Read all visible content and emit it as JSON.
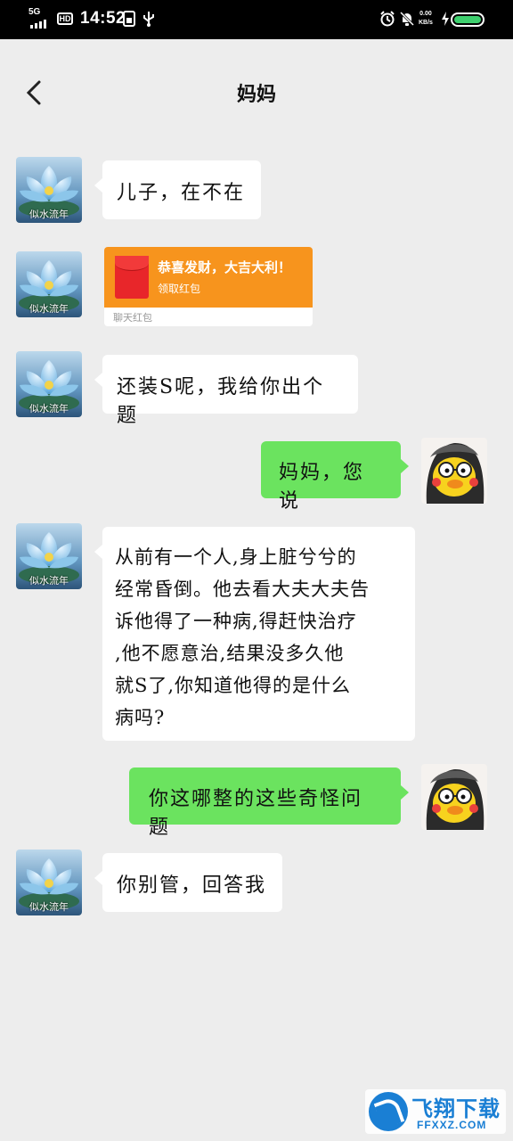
{
  "status_bar": {
    "network": "5G",
    "hd": "HD",
    "time": "14:52",
    "speed_value": "0.00",
    "speed_unit": "KB/s",
    "battery_level": 1.0,
    "battery_color": "#3ecf6e"
  },
  "header": {
    "title": "妈妈"
  },
  "avatars": {
    "mom_caption": "似水流年"
  },
  "messages": [
    {
      "from": "mom",
      "text": "儿子，在不在"
    },
    {
      "from": "mom",
      "type": "red_packet",
      "title": "恭喜发财，大吉大利！",
      "subtitle": "领取红包",
      "footer": "聊天红包"
    },
    {
      "from": "mom",
      "text": "还装S呢，我给你出个题"
    },
    {
      "from": "me",
      "text": "妈妈，您说"
    },
    {
      "from": "mom",
      "lines": [
        "从前有一个人,身上脏兮兮的",
        "经常昏倒。他去看大夫大夫告",
        "诉他得了一种病,得赶快治疗",
        ",他不愿意治,结果没多久他",
        "就S了,你知道他得的是什么",
        "病吗?"
      ]
    },
    {
      "from": "me",
      "text": "你这哪整的这些奇怪问题"
    },
    {
      "from": "mom",
      "text": "你别管，回答我"
    }
  ],
  "watermark": {
    "name": "飞翔下载",
    "url": "FFXXZ.COM"
  },
  "colors": {
    "background": "#ededed",
    "outgoing_bubble": "#6be35f",
    "incoming_bubble": "#ffffff",
    "red_packet": "#f7941d"
  }
}
